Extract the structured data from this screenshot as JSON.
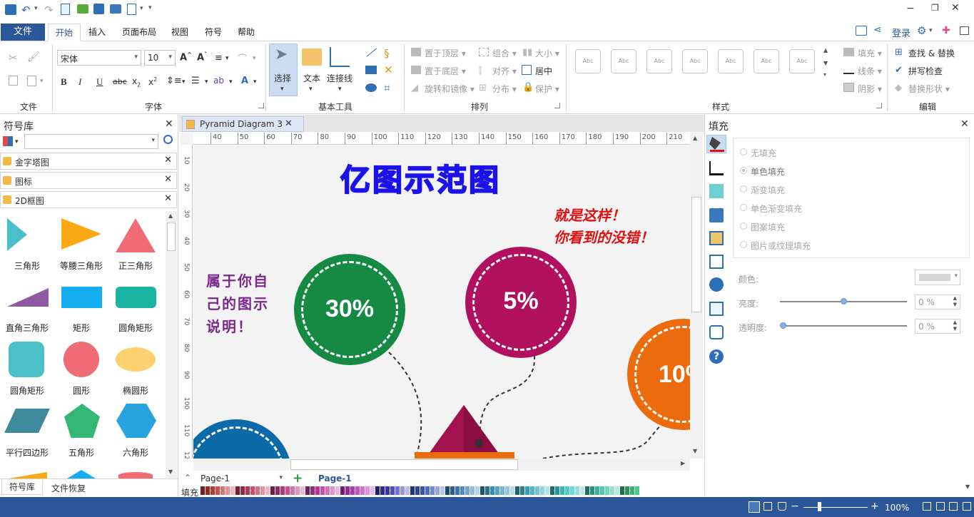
{
  "quick_access": {
    "icons": [
      "app-icon",
      "undo-icon",
      "redo-icon",
      "new-icon",
      "open-icon",
      "save-icon",
      "print-icon",
      "export-icon",
      "customize-icon"
    ]
  },
  "window": {
    "minimize": "−",
    "restore": "❐",
    "close": "✕"
  },
  "menu": {
    "file": "文件",
    "home": "开始",
    "insert": "插入",
    "page_layout": "页面布局",
    "view": "视图",
    "symbol": "符号",
    "help": "帮助",
    "login": "登录"
  },
  "ribbon": {
    "font_name": "宋体",
    "font_size": "10",
    "group_file": "文件",
    "group_font": "字体",
    "group_basic": "基本工具",
    "group_arrange": "排列",
    "group_style": "样式",
    "group_edit": "编辑",
    "select": "选择",
    "text": "文本",
    "connector": "连接线",
    "bring_front": "置于顶层",
    "send_back": "置于底层",
    "rotate": "旋转和镜像",
    "group": "组合",
    "align": "对齐",
    "distribute": "分布",
    "size": "大小",
    "center": "居中",
    "protect": "保护",
    "style_sample": "Abc",
    "fill": "填充",
    "line": "线条",
    "shadow": "阴影",
    "replace_shape": "替换形状",
    "find_replace": "查找 & 替换",
    "spell_check": "拼写检查"
  },
  "left_panel": {
    "title": "符号库",
    "libraries": [
      "金字塔图",
      "图标",
      "2D框图"
    ],
    "shapes": [
      "三角形",
      "等腰三角形",
      "正三角形",
      "直角三角形",
      "矩形",
      "圆角矩形",
      "圆角矩形",
      "圆形",
      "椭圆形",
      "平行四边形",
      "五角形",
      "六角形"
    ],
    "bottom_tabs": [
      "符号库",
      "文件恢复"
    ]
  },
  "doc_tab": {
    "title": "Pyramid Diagram 3"
  },
  "ruler": {
    "h": [
      "40",
      "50",
      "60",
      "70",
      "80",
      "90",
      "100",
      "110",
      "120",
      "130",
      "140",
      "150",
      "160",
      "170",
      "180",
      "190",
      "200",
      "210"
    ],
    "v": [
      "10",
      "20",
      "30",
      "40",
      "50",
      "60",
      "70",
      "80",
      "90",
      "100",
      "110",
      "120"
    ]
  },
  "canvas": {
    "title": "亿图示范图",
    "note_red_1": "就是这样！",
    "note_red_2": "你看到的没错！",
    "note_purple_1": "属于你自",
    "note_purple_2": "己的图示",
    "note_purple_3": "说明！",
    "pct_green": "30%",
    "pct_magenta": "5%",
    "pct_orange": "10%",
    "colors": {
      "green": "#168a45",
      "magenta": "#b0105e",
      "orange": "#ec6b0c",
      "blue": "#0d6aa8",
      "title_blue": "#1a12e8",
      "red_note": "#e01010",
      "purple_note": "#7b2a8c"
    }
  },
  "page_bar": {
    "current": "Page-1",
    "tab": "Page-1",
    "fill_label": "填充"
  },
  "right_panel": {
    "title": "填充",
    "options": [
      "无填充",
      "单色填充",
      "渐变填充",
      "单色渐变填充",
      "图案填充",
      "图片或纹理填充"
    ],
    "color_label": "颜色:",
    "brightness_label": "亮度:",
    "transparency_label": "透明度:",
    "brightness_value": "0 %",
    "transparency_value": "0 %"
  },
  "status": {
    "zoom": "100%"
  }
}
